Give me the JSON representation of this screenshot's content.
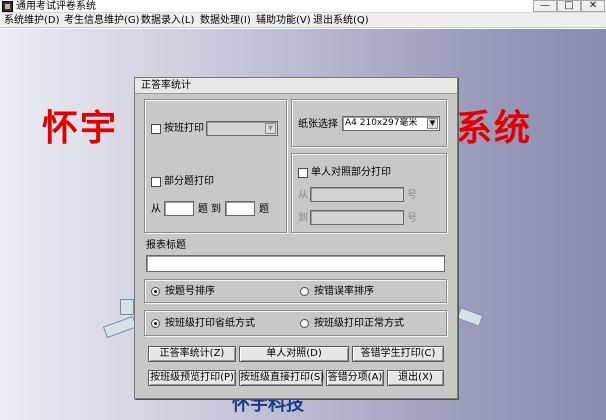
{
  "window": {
    "title": "通用考试评卷系统",
    "min_glyph": "—",
    "max_glyph": "□",
    "close_glyph": "✕"
  },
  "menu": [
    "系统维护(D)",
    "考生信息维护(G)",
    "数据录入(L)",
    "数据处理(I)",
    "辅助功能(V)",
    "退出系统(Q)"
  ],
  "background": {
    "banner_left": "怀宇",
    "banner_right": "系统",
    "logo_text": "怀宇科技"
  },
  "dialog": {
    "title": "正答率统计",
    "class_print": {
      "label": "按班打印",
      "checked": false,
      "value": ""
    },
    "partial_print": {
      "label": "部分题打印",
      "checked": false,
      "from": "从",
      "question": "题",
      "to": "到",
      "from_value": "",
      "to_value": ""
    },
    "paper": {
      "label": "纸张选择",
      "value": "A4 210x297毫米"
    },
    "single_compare": {
      "label": "单人对照部分打印",
      "checked": false,
      "from": "从",
      "to": "到",
      "unit": "号",
      "from_value": "",
      "to_value": ""
    },
    "report_title": {
      "label": "报表标题",
      "value": ""
    },
    "sort": {
      "by_number": "按题号排序",
      "by_error": "按错误率排序",
      "selected": "by_number"
    },
    "print_mode": {
      "save_paper": "按班级打印省纸方式",
      "normal": "按班级打印正常方式",
      "selected": "save_paper"
    },
    "buttons": {
      "stats": "正答率统计(Z)",
      "single": "单人对照(D)",
      "wrong_students": "答错学生打印(C)",
      "class_preview": "按班级预览打印(P)",
      "class_direct": "按班级直接打印(S)",
      "error_items": "答错分项(A)",
      "exit": "退出(X)"
    }
  }
}
